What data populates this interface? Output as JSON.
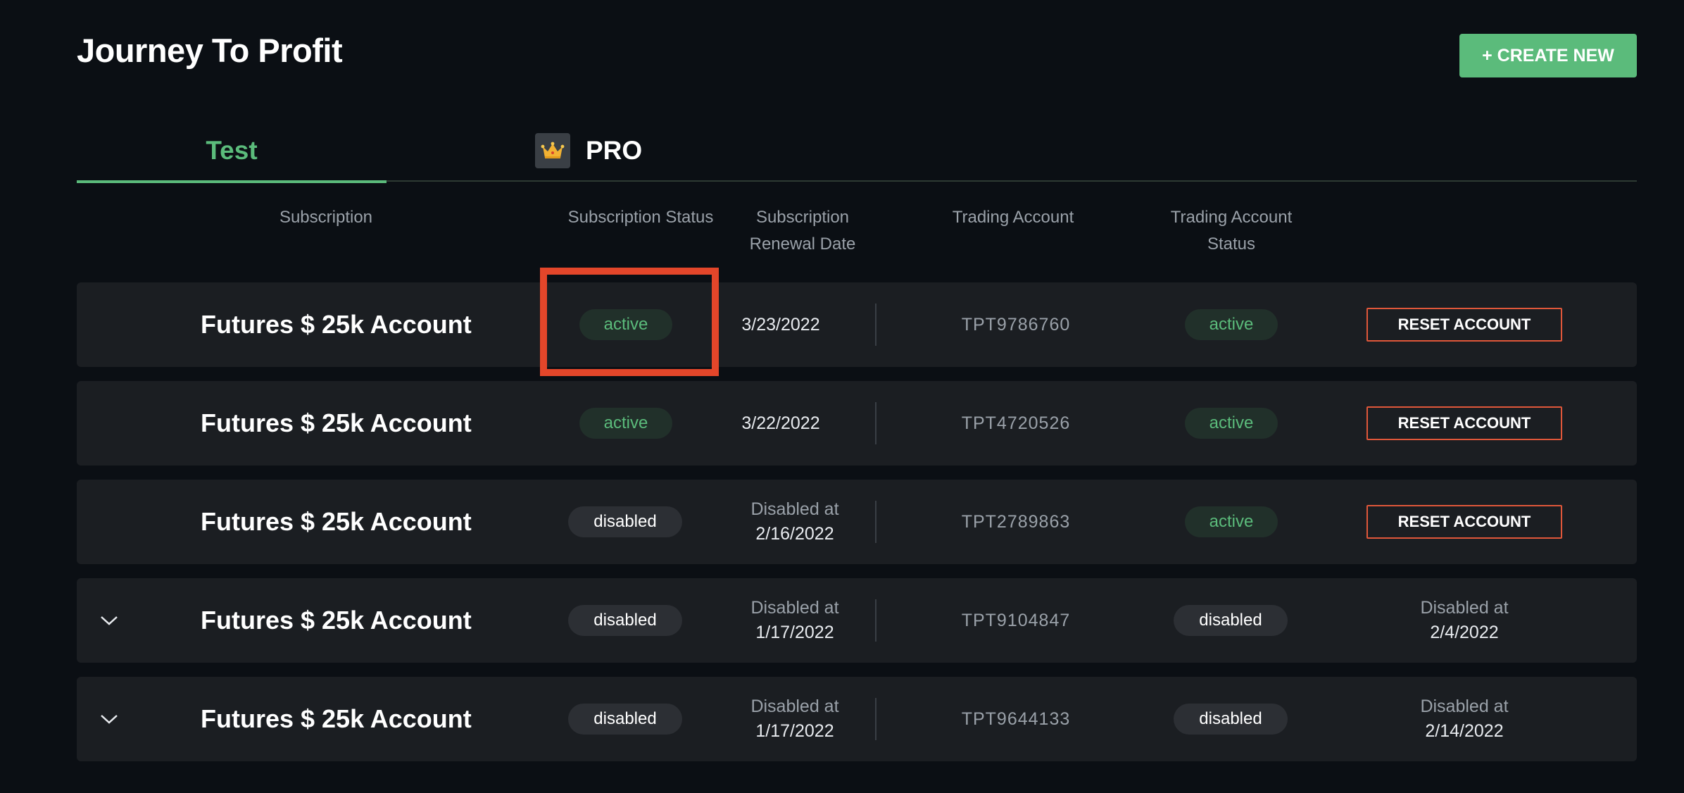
{
  "header": {
    "title": "Journey To Profit",
    "create_button": "+ CREATE NEW"
  },
  "tabs": [
    {
      "label": "Test",
      "active": true
    },
    {
      "label": "PRO",
      "icon": "crown-icon",
      "active": false
    }
  ],
  "columns": {
    "subscription": "Subscription",
    "subscription_status": "Subscription Status",
    "renewal_line1": "Subscription",
    "renewal_line2": "Renewal Date",
    "trading_account": "Trading Account",
    "ta_status_line1": "Trading Account",
    "ta_status_line2": "Status"
  },
  "rows": [
    {
      "name": "Futures $ 25k Account",
      "status": "active",
      "date": "3/23/2022",
      "account": "TPT9786760",
      "ta_status": "active",
      "action": "RESET ACCOUNT"
    },
    {
      "name": "Futures $ 25k Account",
      "status": "active",
      "date": "3/22/2022",
      "account": "TPT4720526",
      "ta_status": "active",
      "action": "RESET ACCOUNT"
    },
    {
      "name": "Futures $ 25k Account",
      "status": "disabled",
      "date_label": "Disabled at",
      "date": "2/16/2022",
      "account": "TPT2789863",
      "ta_status": "active",
      "action": "RESET ACCOUNT"
    },
    {
      "name": "Futures $ 25k Account",
      "status": "disabled",
      "date_label": "Disabled at",
      "date": "1/17/2022",
      "account": "TPT9104847",
      "ta_status": "disabled",
      "right_label": "Disabled at",
      "right_date": "2/4/2022"
    },
    {
      "name": "Futures $ 25k Account",
      "status": "disabled",
      "date_label": "Disabled at",
      "date": "1/17/2022",
      "account": "TPT9644133",
      "ta_status": "disabled",
      "right_label": "Disabled at",
      "right_date": "2/14/2022"
    }
  ],
  "colors": {
    "accent": "#5bbb7b",
    "highlight": "#e3462a",
    "reset_border": "#e0573a"
  }
}
